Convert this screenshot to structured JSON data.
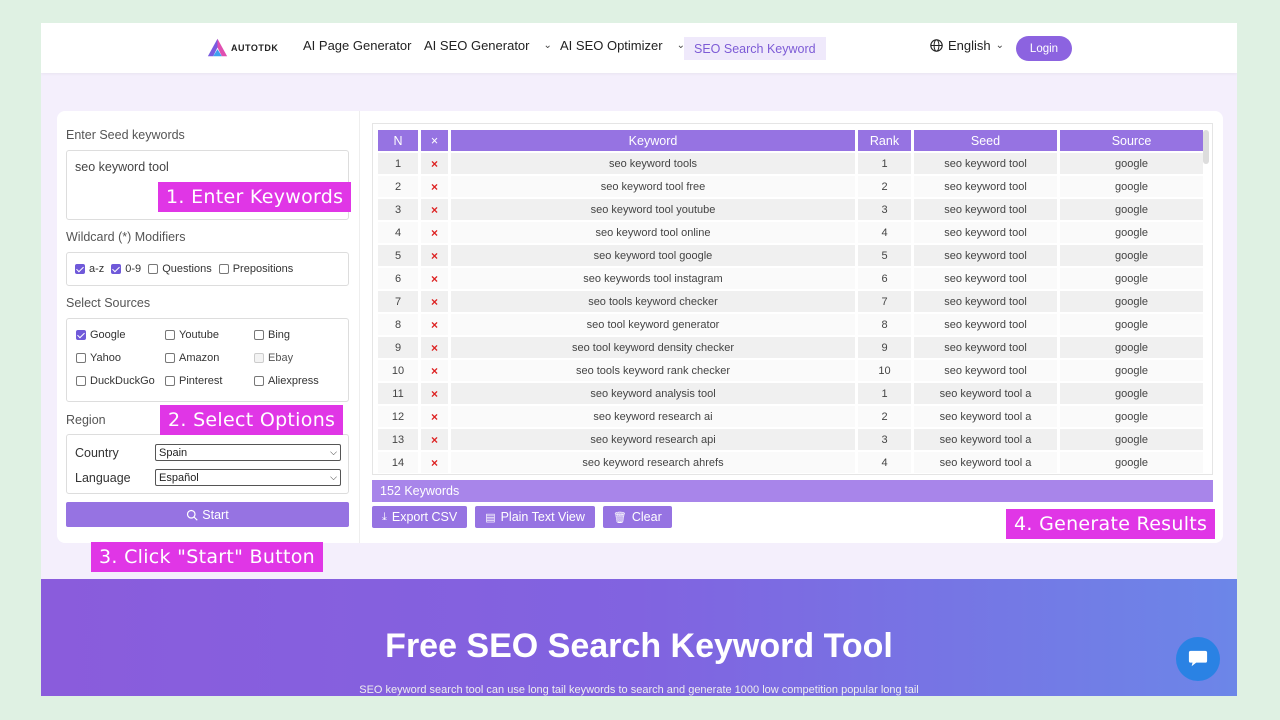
{
  "header": {
    "logo_text": "AUTOTDK",
    "nav": [
      {
        "label": "AI Page Generator"
      },
      {
        "label": "AI SEO Generator"
      },
      {
        "label": "AI SEO Optimizer"
      },
      {
        "label": "SEO Search Keyword"
      }
    ],
    "language": "English",
    "login": "Login"
  },
  "form": {
    "seed_label": "Enter Seed keywords",
    "seed_value": "seo keyword tool",
    "wildcard_label": "Wildcard (*) Modifiers",
    "wildcards": [
      {
        "label": "a-z",
        "checked": true
      },
      {
        "label": "0-9",
        "checked": true
      },
      {
        "label": "Questions",
        "checked": false
      },
      {
        "label": "Prepositions",
        "checked": false
      }
    ],
    "sources_label": "Select Sources",
    "sources": [
      {
        "label": "Google",
        "checked": true
      },
      {
        "label": "Youtube",
        "checked": false
      },
      {
        "label": "Bing",
        "checked": false
      },
      {
        "label": "Yahoo",
        "checked": false
      },
      {
        "label": "Amazon",
        "checked": false
      },
      {
        "label": "Ebay",
        "checked": false,
        "disabled": true
      },
      {
        "label": "DuckDuckGo",
        "checked": false
      },
      {
        "label": "Pinterest",
        "checked": false
      },
      {
        "label": "Aliexpress",
        "checked": false
      }
    ],
    "region_label": "Region",
    "country_label": "Country",
    "country_value": "Spain",
    "language_label": "Language",
    "language_value": "Español",
    "start": "Start"
  },
  "table": {
    "headers": [
      "N",
      "×",
      "Keyword",
      "Rank",
      "Seed",
      "Source"
    ],
    "rows": [
      [
        "1",
        "seo keyword tools",
        "1",
        "seo keyword tool",
        "google"
      ],
      [
        "2",
        "seo keyword tool free",
        "2",
        "seo keyword tool",
        "google"
      ],
      [
        "3",
        "seo keyword tool youtube",
        "3",
        "seo keyword tool",
        "google"
      ],
      [
        "4",
        "seo keyword tool online",
        "4",
        "seo keyword tool",
        "google"
      ],
      [
        "5",
        "seo keyword tool google",
        "5",
        "seo keyword tool",
        "google"
      ],
      [
        "6",
        "seo keywords tool instagram",
        "6",
        "seo keyword tool",
        "google"
      ],
      [
        "7",
        "seo tools keyword checker",
        "7",
        "seo keyword tool",
        "google"
      ],
      [
        "8",
        "seo tool keyword generator",
        "8",
        "seo keyword tool",
        "google"
      ],
      [
        "9",
        "seo tool keyword density checker",
        "9",
        "seo keyword tool",
        "google"
      ],
      [
        "10",
        "seo tools keyword rank checker",
        "10",
        "seo keyword tool",
        "google"
      ],
      [
        "11",
        "seo keyword analysis tool",
        "1",
        "seo keyword tool a",
        "google"
      ],
      [
        "12",
        "seo keyword research ai",
        "2",
        "seo keyword tool a",
        "google"
      ],
      [
        "13",
        "seo keyword research api",
        "3",
        "seo keyword tool a",
        "google"
      ],
      [
        "14",
        "seo keyword research ahrefs",
        "4",
        "seo keyword tool a",
        "google"
      ]
    ],
    "count": "152 Keywords",
    "export_csv": "Export CSV",
    "plain_text": "Plain Text View",
    "clear": "Clear"
  },
  "callouts": {
    "step1": "1. Enter Keywords",
    "step2": "2. Select Options",
    "step3": "3. Click \"Start\" Button",
    "step4": "4. Generate Results"
  },
  "banner": {
    "title": "Free SEO Search Keyword Tool",
    "subtitle": "SEO keyword search tool can use long tail keywords to search and generate 1000 low competition popular long tail"
  },
  "colors": {
    "accent": "#9673e2",
    "callout": "#e036e6",
    "delete": "#dd2222"
  }
}
